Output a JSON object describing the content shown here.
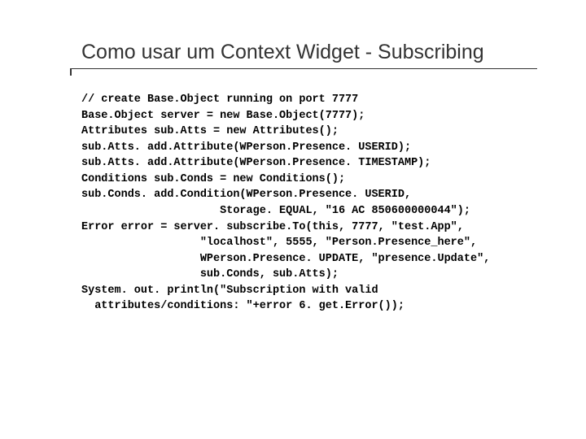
{
  "title": "Como usar um Context Widget - Subscribing",
  "code_lines": [
    "// create Base.Object running on port 7777",
    "Base.Object server = new Base.Object(7777);",
    "Attributes sub.Atts = new Attributes();",
    "sub.Atts. add.Attribute(WPerson.Presence. USERID);",
    "sub.Atts. add.Attribute(WPerson.Presence. TIMESTAMP);",
    "Conditions sub.Conds = new Conditions();",
    "sub.Conds. add.Condition(WPerson.Presence. USERID,",
    "                     Storage. EQUAL, \"16 AC 850600000044\");",
    "Error error = server. subscribe.To(this, 7777, \"test.App\",",
    "                  \"localhost\", 5555, \"Person.Presence_here\",",
    "                  WPerson.Presence. UPDATE, \"presence.Update\",",
    "                  sub.Conds, sub.Atts);",
    "System. out. println(\"Subscription with valid",
    "  attributes/conditions: \"+error 6. get.Error());"
  ]
}
